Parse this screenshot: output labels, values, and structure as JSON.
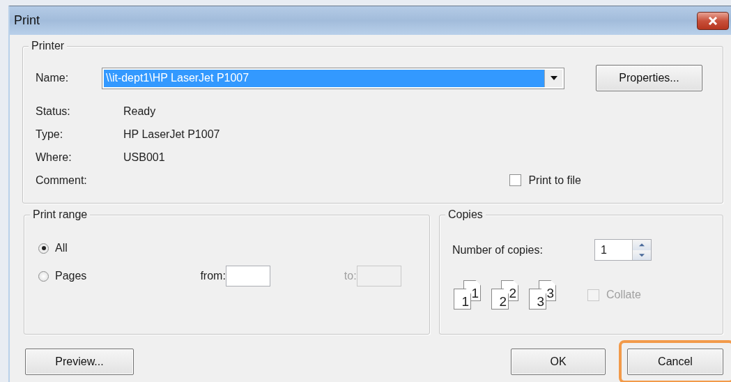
{
  "window": {
    "title": "Print"
  },
  "printer": {
    "title": "Printer",
    "name_label": "Name:",
    "name_value": "\\\\it-dept1\\HP LaserJet P1007",
    "properties_button": "Properties...",
    "info": [
      {
        "label": "Status:",
        "value": "Ready"
      },
      {
        "label": "Type:",
        "value": "HP LaserJet P1007"
      },
      {
        "label": "Where:",
        "value": "USB001"
      },
      {
        "label": "Comment:"
      }
    ],
    "print_to_file": {
      "label": "Print to file",
      "checked": false
    }
  },
  "print_range": {
    "title": "Print range",
    "options": [
      {
        "label": "All",
        "selected": true
      },
      {
        "label": "Pages",
        "selected": false
      }
    ],
    "from_label": "from:",
    "to_label": "to:",
    "to_disabled": true
  },
  "copies": {
    "title": "Copies",
    "number_label": "Number of copies:",
    "number_value": "1",
    "collate_pages": [
      {
        "front": "1",
        "back": "1"
      },
      {
        "front": "2",
        "back": "2"
      },
      {
        "front": "3",
        "back": "3"
      }
    ],
    "collate": {
      "label": "Collate",
      "checked": false,
      "disabled": true
    }
  },
  "buttons": [
    {
      "label": "Preview...",
      "highlighted": false
    },
    {
      "label": "OK",
      "highlighted": false
    },
    {
      "label": "Cancel",
      "highlighted": true
    }
  ]
}
